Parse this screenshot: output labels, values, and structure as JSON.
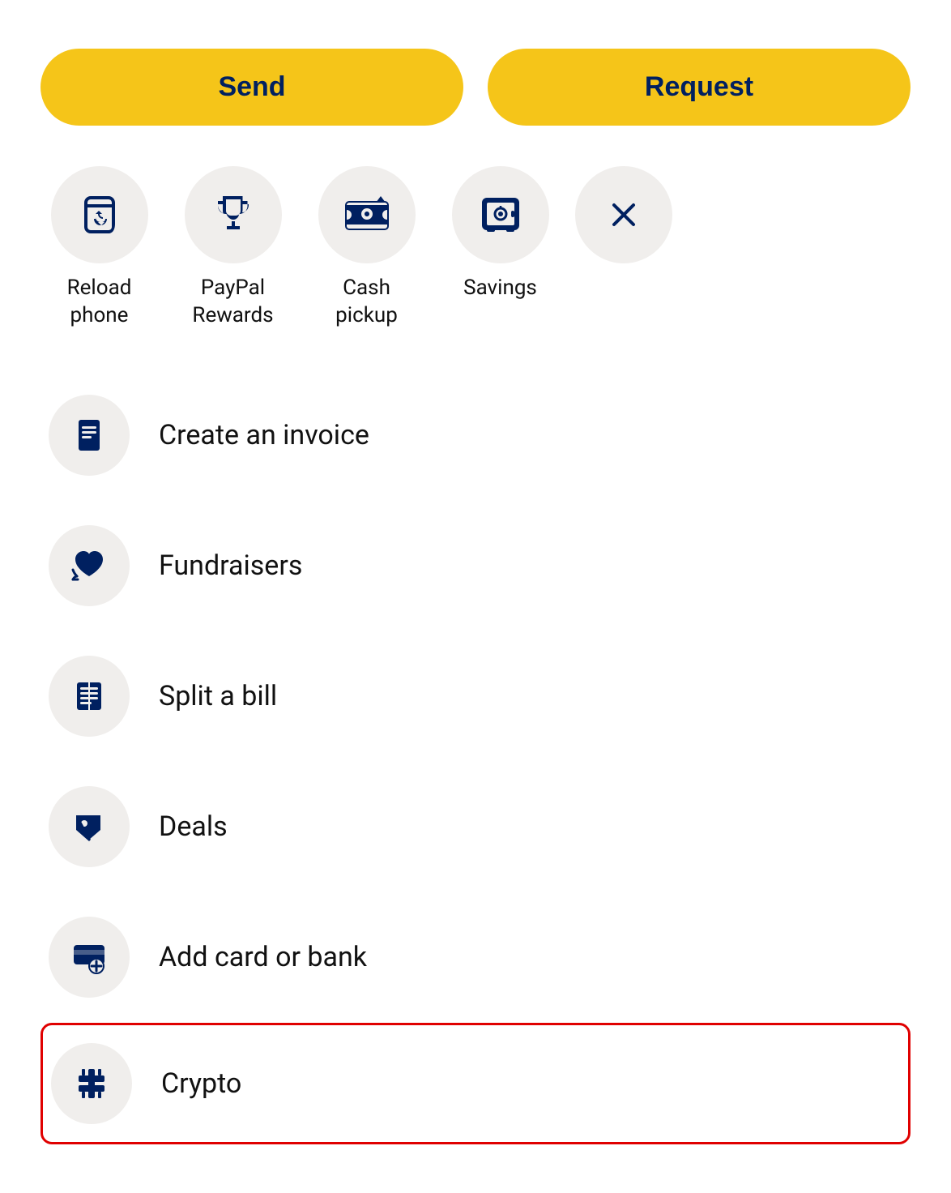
{
  "buttons": {
    "send_label": "Send",
    "request_label": "Request"
  },
  "quick_actions": [
    {
      "id": "reload-phone",
      "label": "Reload phone",
      "icon": "phone-reload-icon"
    },
    {
      "id": "paypal-rewards",
      "label": "PayPal Rewards",
      "icon": "trophy-icon"
    },
    {
      "id": "cash-pickup",
      "label": "Cash pickup",
      "icon": "cash-icon"
    },
    {
      "id": "savings",
      "label": "Savings",
      "icon": "safe-icon"
    },
    {
      "id": "close",
      "label": "",
      "icon": "close-icon"
    }
  ],
  "list_items": [
    {
      "id": "create-invoice",
      "label": "Create an invoice",
      "icon": "invoice-icon"
    },
    {
      "id": "fundraisers",
      "label": "Fundraisers",
      "icon": "fundraisers-icon"
    },
    {
      "id": "split-bill",
      "label": "Split a bill",
      "icon": "split-bill-icon"
    },
    {
      "id": "deals",
      "label": "Deals",
      "icon": "deals-icon"
    },
    {
      "id": "add-card-or-bank",
      "label": "Add card or bank",
      "icon": "add-card-icon"
    },
    {
      "id": "crypto",
      "label": "Crypto",
      "icon": "crypto-icon",
      "highlighted": true
    }
  ]
}
